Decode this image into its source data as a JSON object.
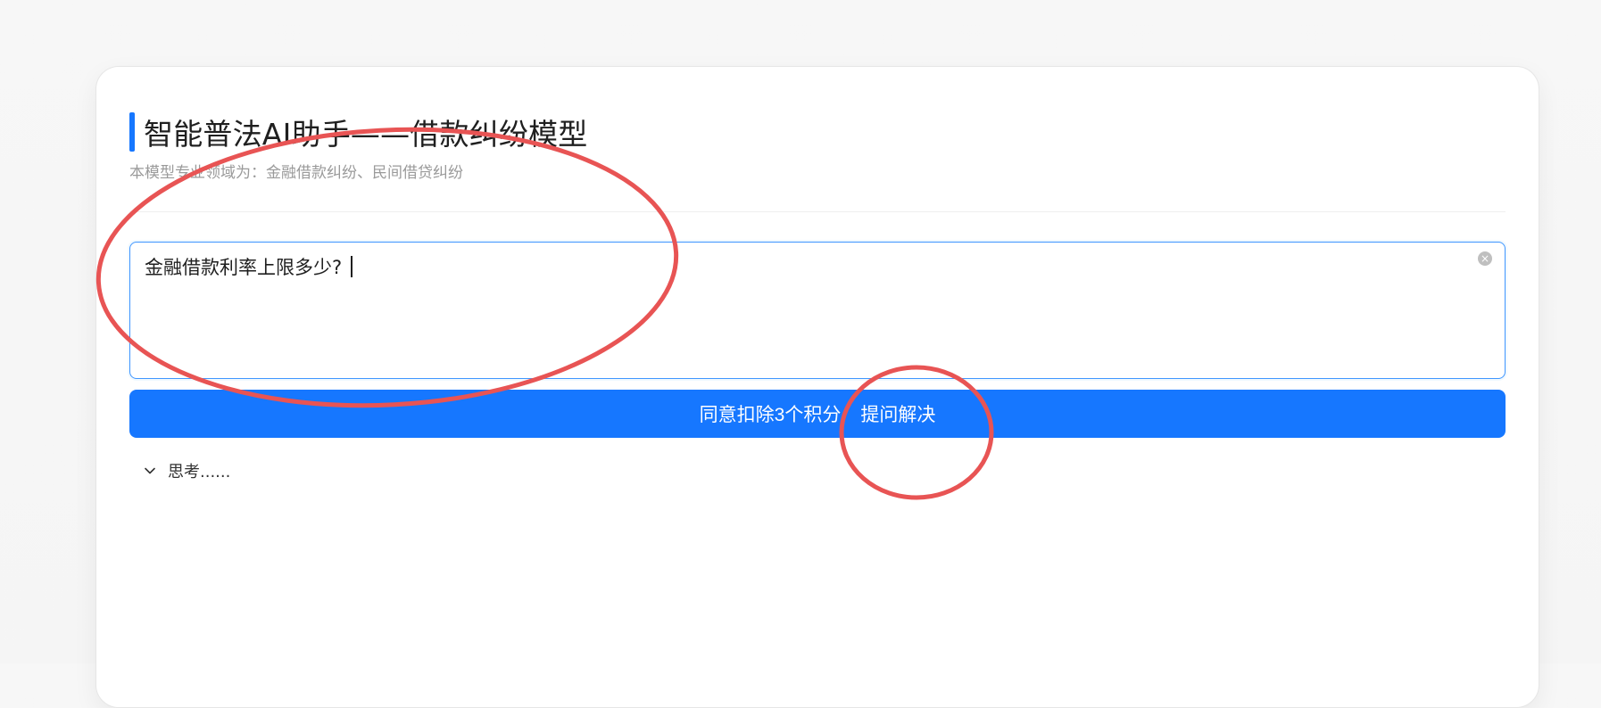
{
  "header": {
    "title": "智能普法AI助手——借款纠纷模型",
    "subtitle": "本模型专业领域为：金融借款纠纷、民间借贷纠纷"
  },
  "question_input": {
    "value": "金融借款利率上限多少?"
  },
  "submit": {
    "label_part1": "同意扣除3个积分",
    "label_part2": "提问解决"
  },
  "thinking": {
    "label": "思考......"
  },
  "colors": {
    "accent": "#1677ff",
    "annotation": "#e85454"
  },
  "icons": {
    "clear": "clear-circle-icon",
    "toggle": "chevron-down-icon"
  }
}
